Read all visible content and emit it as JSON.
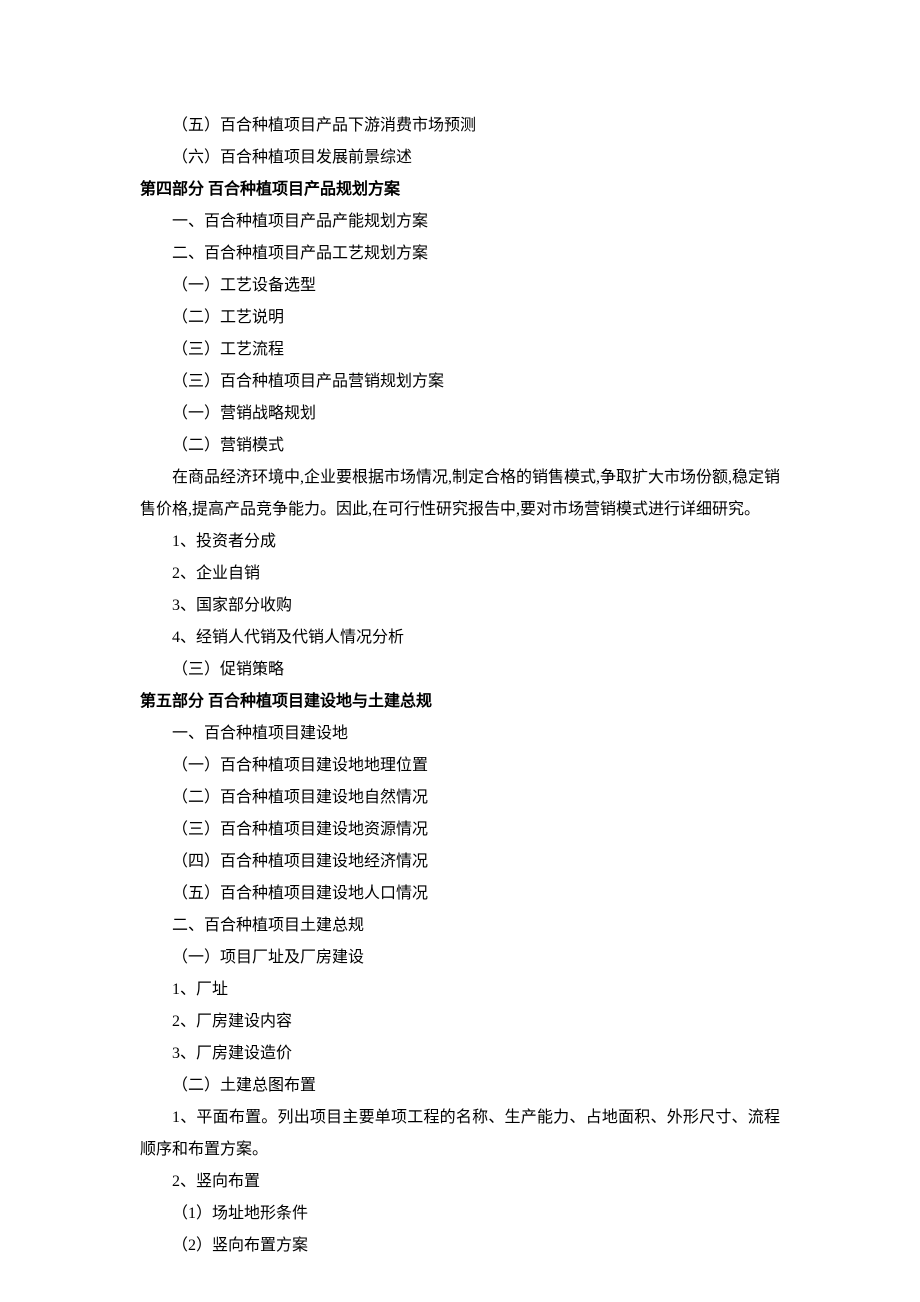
{
  "lines": {
    "l1": "（五）百合种植项目产品下游消费市场预测",
    "l2": "（六）百合种植项目发展前景综述",
    "h4": "第四部分 百合种植项目产品规划方案",
    "l3": "一、百合种植项目产品产能规划方案",
    "l4": "二、百合种植项目产品工艺规划方案",
    "l5": "（一）工艺设备选型",
    "l6": "（二）工艺说明",
    "l7": "（三）工艺流程",
    "l8": "（三）百合种植项目产品营销规划方案",
    "l9": "（一）营销战略规划",
    "l10": "（二）营销模式",
    "p1": "在商品经济环境中,企业要根据市场情况,制定合格的销售模式,争取扩大市场份额,稳定销售价格,提高产品竞争能力。因此,在可行性研究报告中,要对市场营销模式进行详细研究。",
    "l11": "1、投资者分成",
    "l12": "2、企业自销",
    "l13": "3、国家部分收购",
    "l14": "4、经销人代销及代销人情况分析",
    "l15": "（三）促销策略",
    "h5": "第五部分  百合种植项目建设地与土建总规",
    "l16": "一、百合种植项目建设地",
    "l17": "（一）百合种植项目建设地地理位置",
    "l18": "（二）百合种植项目建设地自然情况",
    "l19": "（三）百合种植项目建设地资源情况",
    "l20": "（四）百合种植项目建设地经济情况",
    "l21": "（五）百合种植项目建设地人口情况",
    "l22": "二、百合种植项目土建总规",
    "l23": "（一）项目厂址及厂房建设",
    "l24": "1、厂址",
    "l25": "2、厂房建设内容",
    "l26": "3、厂房建设造价",
    "l27": "（二）土建总图布置",
    "p2": "1、平面布置。列出项目主要单项工程的名称、生产能力、占地面积、外形尺寸、流程顺序和布置方案。",
    "l28": "2、竖向布置",
    "l29": "（1）场址地形条件",
    "l30": "（2）竖向布置方案"
  }
}
